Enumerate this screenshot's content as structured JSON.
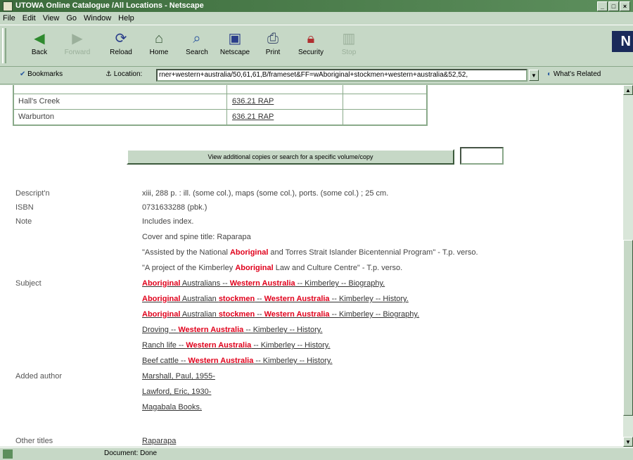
{
  "window": {
    "title": "UTOWA Online Catalogue /All Locations - Netscape"
  },
  "menu": [
    "File",
    "Edit",
    "View",
    "Go",
    "Window",
    "Help"
  ],
  "toolbar": {
    "back": "Back",
    "forward": "Forward",
    "reload": "Reload",
    "home": "Home",
    "search": "Search",
    "netscape": "Netscape",
    "print": "Print",
    "security": "Security",
    "stop": "Stop"
  },
  "location": {
    "bookmarks": "Bookmarks",
    "label": "Location:",
    "url": "rner+western+australia/50,61,61,B/frameset&FF=wAboriginal+stockmen+western+australia&52,52,",
    "related": "What's Related"
  },
  "copies": [
    {
      "location": "Hall's Creek",
      "callno": "636.21 RAP"
    },
    {
      "location": "Warburton",
      "callno": "636.21 RAP"
    }
  ],
  "view_button": "View additional copies or search for a specific volume/copy",
  "record": {
    "descript_label": "Descript'n",
    "descript": "xiii, 288 p. : ill. (some col.), maps (some col.), ports. (some col.) ; 25 cm.",
    "isbn_label": "ISBN",
    "isbn": "0731633288 (pbk.)",
    "note_label": "Note",
    "notes": {
      "n1": "Includes index.",
      "n2": "Cover and spine title: Raparapa",
      "n3a": "\"Assisted by the National ",
      "n3h": "Aboriginal",
      "n3b": " and Torres Strait Islander Bicentennial Program\" - T.p. verso.",
      "n4a": "\"A project of the Kimberley ",
      "n4h": "Aboriginal",
      "n4b": " Law and Culture Centre\" - T.p. verso."
    },
    "subject_label": "Subject",
    "subjects": {
      "s1a": "Aboriginal",
      "s1b": " Australians -- ",
      "s1c": "Western Australia",
      "s1d": " -- Kimberley -- Biography.",
      "s2a": "Aboriginal",
      "s2b": " Australian ",
      "s2c": "stockmen",
      "s2d": " -- ",
      "s2e": "Western Australia",
      "s2f": " -- Kimberley -- History.",
      "s3a": "Aboriginal",
      "s3b": " Australian ",
      "s3c": "stockmen",
      "s3d": " -- ",
      "s3e": "Western Australia",
      "s3f": " -- Kimberley -- Biography.",
      "s4a": "Droving -- ",
      "s4b": "Western Australia",
      "s4c": " -- Kimberley -- History.",
      "s5a": "Ranch life -- ",
      "s5b": "Western Australia",
      "s5c": " -- Kimberley -- History.",
      "s6a": "Beef cattle -- ",
      "s6b": "Western Australia",
      "s6c": " -- Kimberley -- History."
    },
    "added_author_label": "Added author",
    "authors": [
      "Marshall, Paul, 1955-",
      "Lawford, Eric, 1930-",
      "Magabala Books."
    ],
    "other_titles_label": "Other titles",
    "other_title": "Raparapa"
  },
  "status": {
    "text": "Document: Done"
  }
}
